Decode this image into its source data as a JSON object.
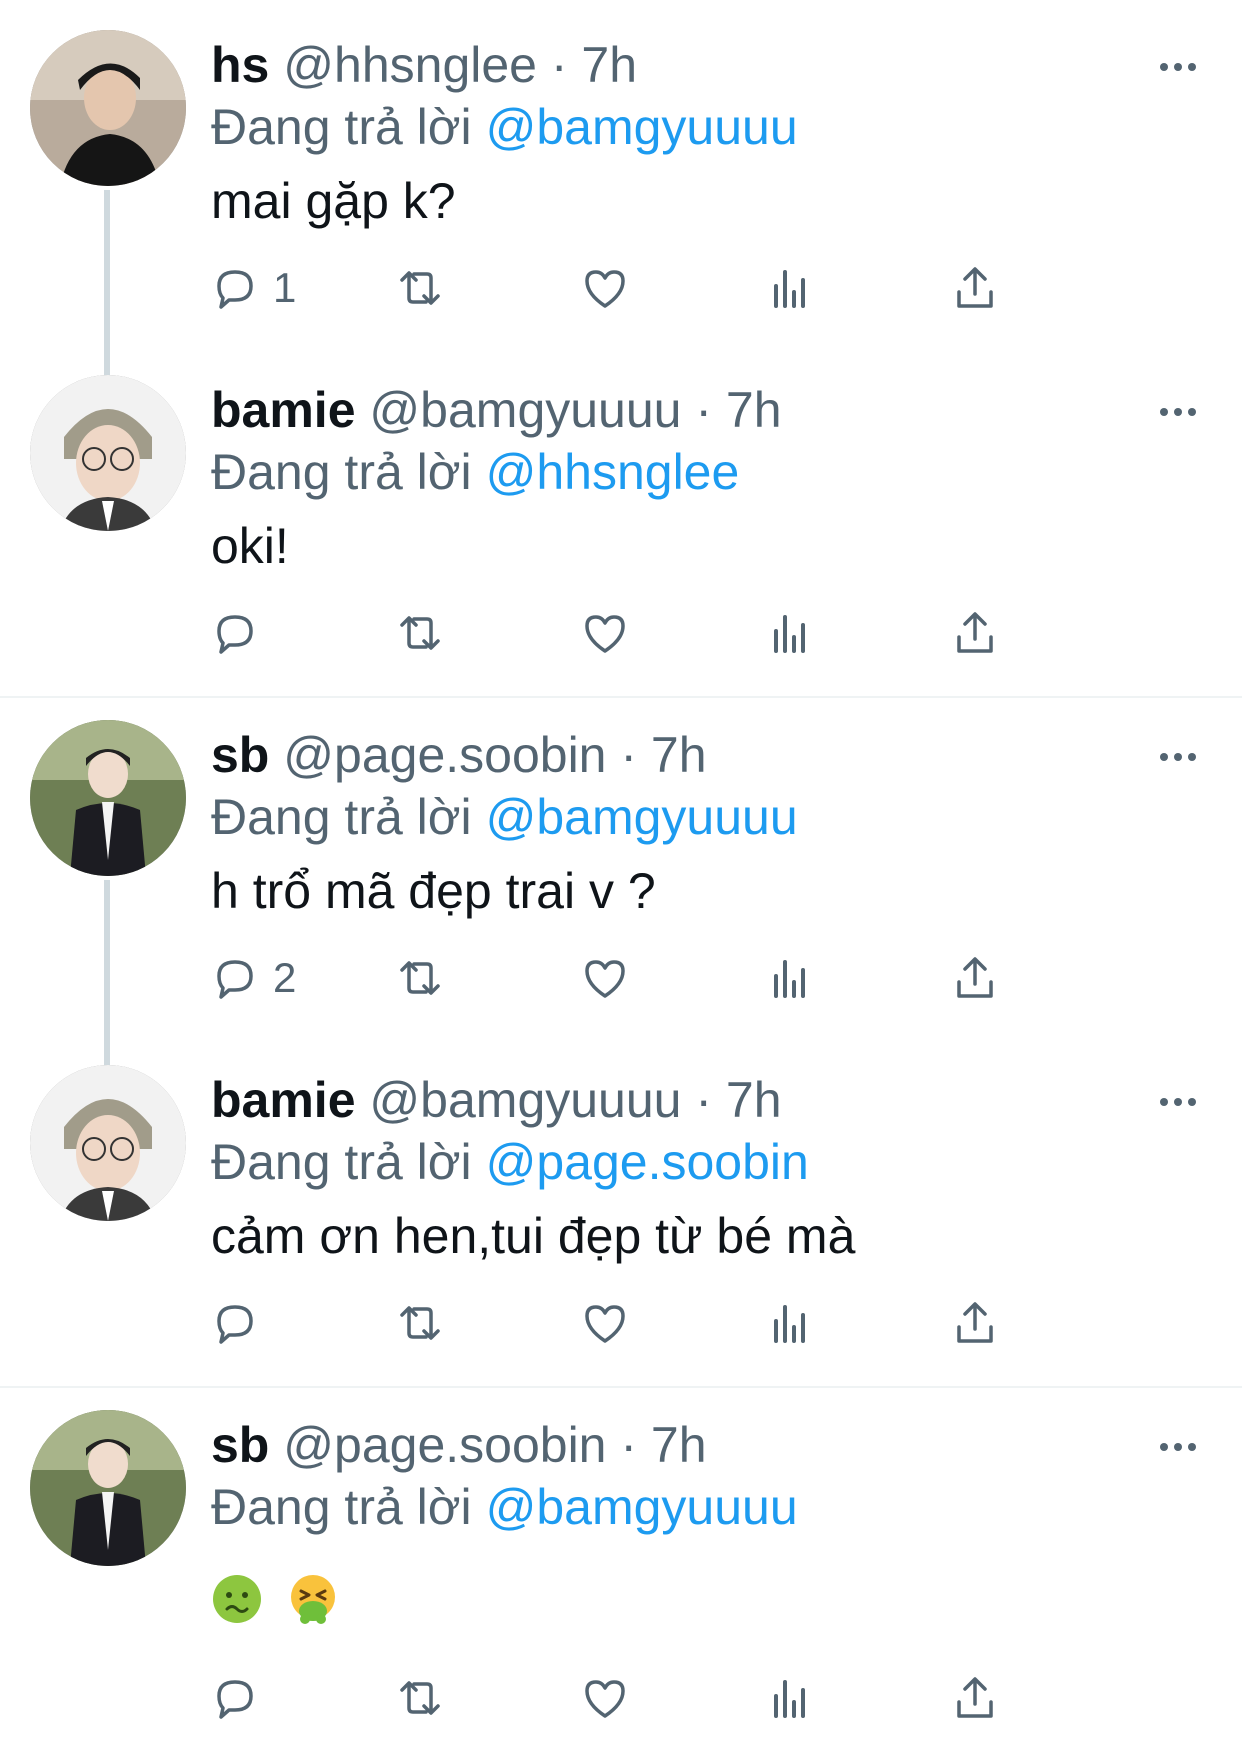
{
  "tweets": [
    {
      "name": "hs",
      "handle": "@hhsnglee · 7h",
      "reply_prefix": "Đang trả lời",
      "reply_to": "@bamgyuuuu",
      "text": "mai gặp k?",
      "reply_count": "1",
      "avatar": "person-dark-hair-black-shirt"
    },
    {
      "name": "bamie",
      "handle": "@bamgyuuuu · 7h",
      "reply_prefix": "Đang trả lời",
      "reply_to": "@hhsnglee",
      "text": "oki!",
      "reply_count": "",
      "avatar": "person-light-hair-glasses-suit"
    },
    {
      "name": "sb",
      "handle": "@page.soobin · 7h",
      "reply_prefix": "Đang trả lời",
      "reply_to": "@bamgyuuuu",
      "text": "h trổ mã đẹp trai v ?",
      "reply_count": "2",
      "avatar": "person-glasses-black-cardigan-outdoor"
    },
    {
      "name": "bamie",
      "handle": "@bamgyuuuu · 7h",
      "reply_prefix": "Đang trả lời",
      "reply_to": "@page.soobin",
      "text": "cảm ơn hen,tui đẹp từ bé mà",
      "reply_count": "",
      "avatar": "person-light-hair-glasses-suit"
    },
    {
      "name": "sb",
      "handle": "@page.soobin · 7h",
      "reply_prefix": "Đang trả lời",
      "reply_to": "@bamgyuuuu",
      "text": "",
      "emojis": [
        "nauseated-face",
        "vomiting-face"
      ],
      "reply_count": "",
      "avatar": "person-glasses-black-cardigan-outdoor"
    }
  ],
  "icons": [
    "reply-icon",
    "retweet-icon",
    "like-icon",
    "views-icon",
    "share-icon",
    "more-icon"
  ],
  "colors": {
    "mention": "#1d9bf0",
    "secondary_text": "#536471",
    "thread_line": "#cfd9de"
  }
}
